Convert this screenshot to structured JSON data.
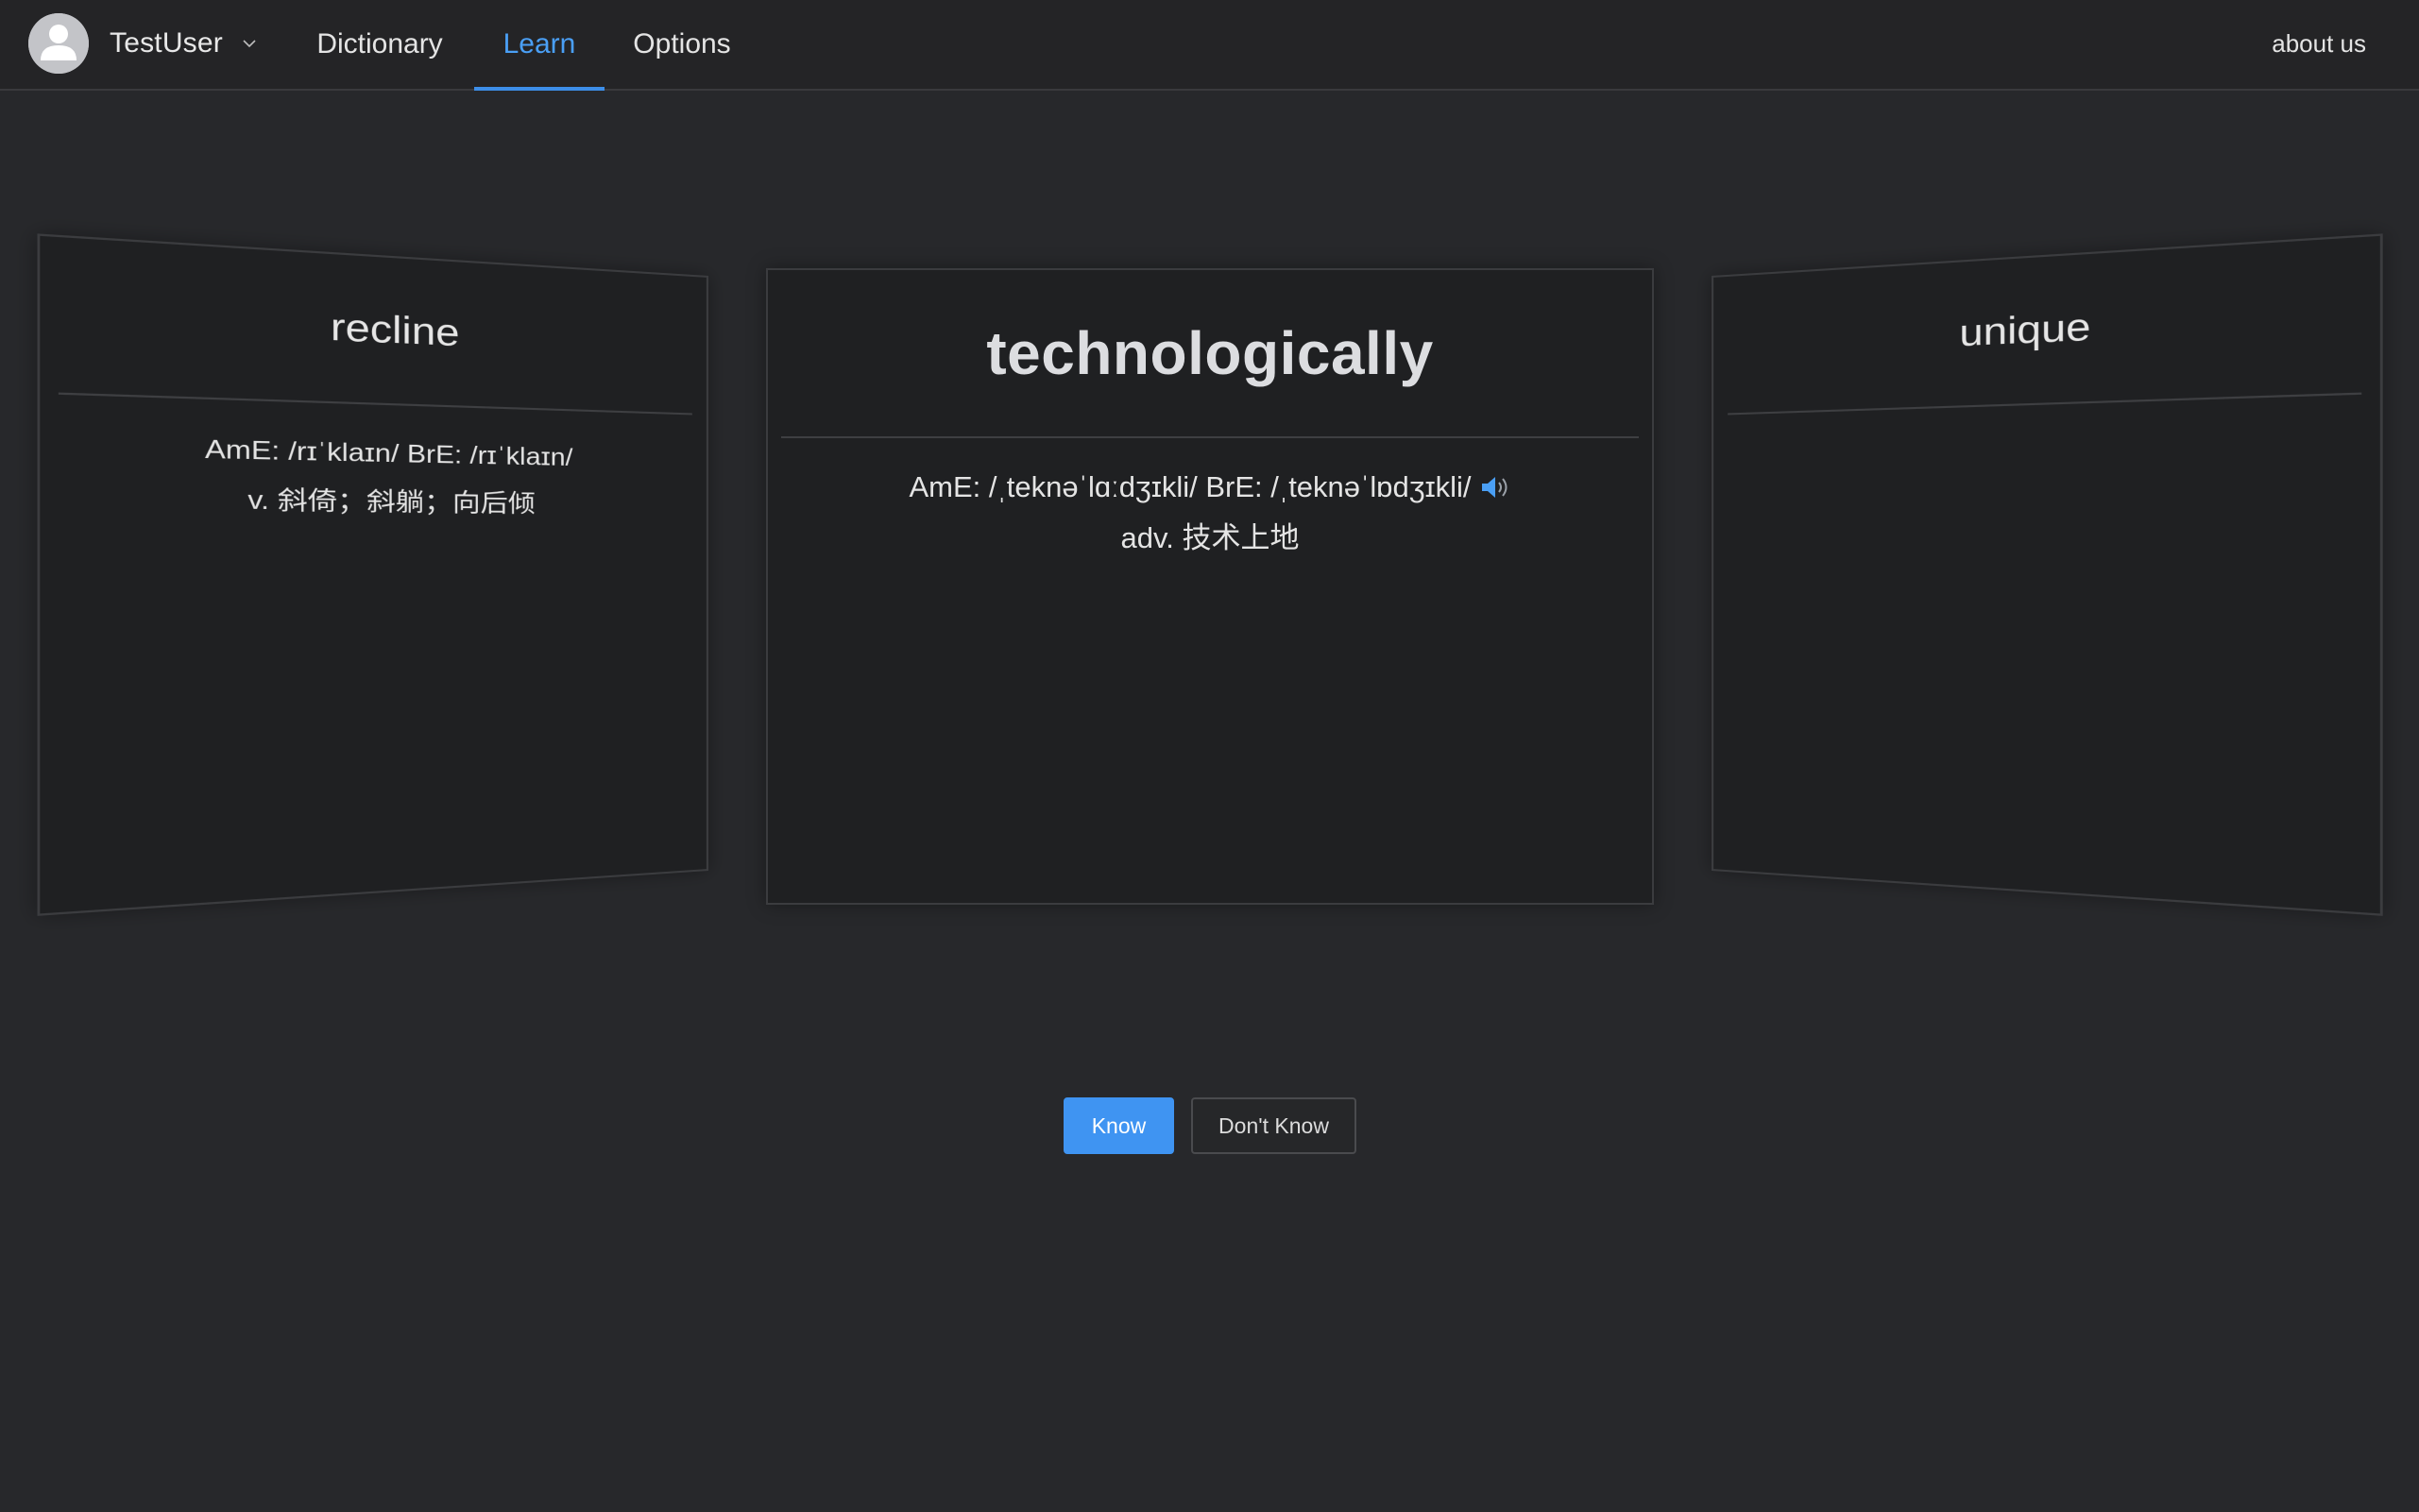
{
  "header": {
    "username": "TestUser",
    "nav": {
      "dictionary": "Dictionary",
      "learn": "Learn",
      "options": "Options"
    },
    "active_tab": "Learn",
    "about": "about us"
  },
  "cards": {
    "previous": {
      "word": "recline",
      "phonetic": "AmE: /rɪˈklaɪn/ BrE: /rɪˈklaɪn/",
      "definition": "v. 斜倚；斜躺；向后倾"
    },
    "current": {
      "word": "technologically",
      "phonetic": "AmE: /ˌteknəˈlɑːdʒɪkli/ BrE: /ˌteknəˈlɒdʒɪkli/",
      "definition": "adv. 技术上地"
    },
    "next": {
      "word": "unique"
    }
  },
  "actions": {
    "know": "Know",
    "dont_know": "Don't Know"
  },
  "colors": {
    "accent": "#3f94f2",
    "background": "#27282b",
    "card": "#1f2022"
  }
}
